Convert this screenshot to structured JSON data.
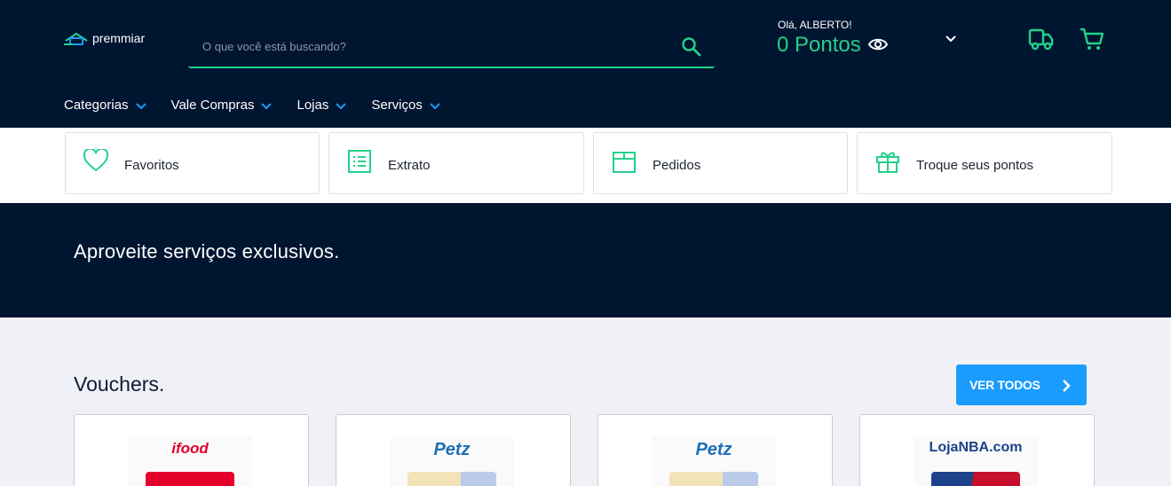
{
  "header": {
    "logo_text": "premmiar",
    "search_placeholder": "O que você está buscando?",
    "greeting": "Olá, ALBERTO!",
    "points": "0 Pontos"
  },
  "nav": {
    "items": [
      {
        "label": "Categorias"
      },
      {
        "label": "Vale Compras"
      },
      {
        "label": "Lojas"
      },
      {
        "label": "Serviços"
      }
    ]
  },
  "quick_links": [
    {
      "label": "Favoritos",
      "icon": "heart-icon"
    },
    {
      "label": "Extrato",
      "icon": "list-icon"
    },
    {
      "label": "Pedidos",
      "icon": "box-icon"
    },
    {
      "label": "Troque seus pontos",
      "icon": "gift-icon"
    }
  ],
  "hero": {
    "title": "Aproveite serviços exclusivos."
  },
  "vouchers": {
    "title": "Vouchers.",
    "button_label": "VER TODOS",
    "cards": [
      {
        "brand": "ifood",
        "brand_color": "#e4002b"
      },
      {
        "brand": "Petz",
        "brand_color": "#1f6fb7"
      },
      {
        "brand": "Petz",
        "brand_color": "#1f6fb7"
      },
      {
        "brand": "LojaNBA.com",
        "brand_color": "#1d428a"
      }
    ]
  },
  "colors": {
    "navy": "#001530",
    "accent_green": "#23d18b",
    "button_blue": "#1a9cff"
  }
}
